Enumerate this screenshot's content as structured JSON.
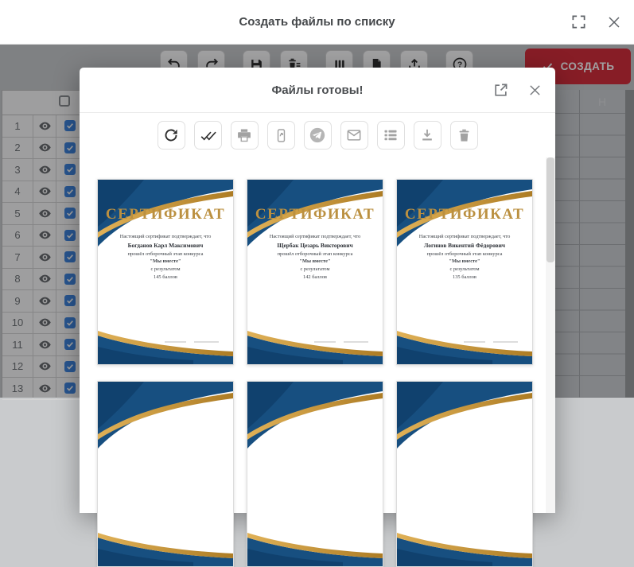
{
  "app_header": {
    "title": "Создать файлы по списку"
  },
  "background": {
    "toolbar": {
      "icons": [
        "undo",
        "redo",
        "save",
        "clear-list",
        "columns",
        "insert-file",
        "export",
        "help"
      ],
      "create_button_label": "СОЗДАТЬ",
      "create_button_color": "#d52b38"
    },
    "table": {
      "rows": [
        1,
        2,
        3,
        4,
        5,
        6,
        7,
        8,
        9,
        10,
        11,
        12,
        13
      ],
      "all_rows_checked": true,
      "header_checkbox_checked": false,
      "checkbox_color": "#3d85e0"
    },
    "spreadsheet": {
      "visible_column_header": "H"
    }
  },
  "modal": {
    "title": "Файлы готовы!",
    "header_icons": [
      "open-in-new",
      "close"
    ],
    "toolbar_icons": [
      "refresh",
      "double-check",
      "print",
      "phone-share",
      "telegram",
      "email",
      "list",
      "download",
      "delete"
    ],
    "certificates": [
      {
        "heading": "СЕРТИФИКАТ",
        "line1": "Настоящий сертификат подтверждает, что",
        "name": "Богданов Карл Максимович",
        "line2": "прошёл отборочный этап конкурса",
        "line3": "\"Мы вместе\"",
        "line4": "с результатом",
        "score": "145 баллов"
      },
      {
        "heading": "СЕРТИФИКАТ",
        "line1": "Настоящий сертификат подтверждает, что",
        "name": "Щербак Цезарь Викторович",
        "line2": "прошёл отборочный этап конкурса",
        "line3": "\"Мы вместе\"",
        "line4": "с результатом",
        "score": "142 баллов"
      },
      {
        "heading": "СЕРТИФИКАТ",
        "line1": "Настоящий сертификат подтверждает, что",
        "name": "Логинов Викентий Фёдорович",
        "line2": "прошёл отборочный этап конкурса",
        "line3": "\"Мы вместе\"",
        "line4": "с результатом",
        "score": "135 баллов"
      }
    ],
    "partial_next_row_count": 3,
    "certificate_colors": {
      "blue": "#174f80",
      "gold": "#c09032"
    }
  }
}
